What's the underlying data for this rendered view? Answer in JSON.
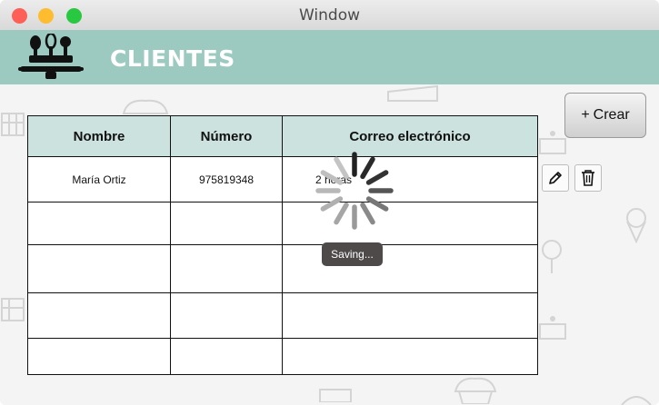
{
  "window": {
    "title": "Window"
  },
  "header": {
    "title": "CLIENTES",
    "background": "#9ccac0"
  },
  "toolbar": {
    "create_label": "Crear",
    "create_icon": "+"
  },
  "table": {
    "columns": [
      "Nombre",
      "Número",
      "Correo electrónico"
    ],
    "rows": [
      [
        "María Ortiz",
        "975819348",
        "2 horas"
      ],
      [
        "",
        "",
        ""
      ],
      [
        "",
        "",
        ""
      ],
      [
        "",
        "",
        ""
      ],
      [
        "",
        "",
        ""
      ]
    ],
    "header_color": "#cce2de"
  },
  "row_actions": {
    "edit_icon": "pencil-icon",
    "delete_icon": "trash-icon"
  },
  "status": {
    "saving_text": "Saving..."
  }
}
